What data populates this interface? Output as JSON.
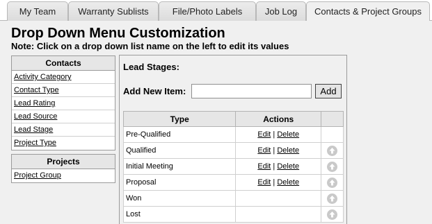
{
  "tabs": [
    {
      "label": "My Team"
    },
    {
      "label": "Warranty Sublists"
    },
    {
      "label": "File/Photo Labels"
    },
    {
      "label": "Job Log"
    },
    {
      "label": "Contacts & Project Groups"
    }
  ],
  "header": {
    "title": "Drop Down Menu Customization",
    "note": "Note: Click on a drop down list name on the left to edit its values"
  },
  "sidebar": {
    "contacts": {
      "heading": "Contacts",
      "items": [
        "Activity Category",
        "Contact Type",
        "Lead Rating",
        "Lead Source",
        "Lead Stage",
        "Project Type"
      ]
    },
    "projects": {
      "heading": "Projects",
      "items": [
        "Project Group"
      ]
    }
  },
  "panel": {
    "title": "Lead Stages:",
    "add_label": "Add New Item:",
    "add_value": "",
    "add_button": "Add",
    "columns": [
      "Type",
      "Actions"
    ],
    "edit_label": "Edit",
    "separator": "|",
    "delete_label": "Delete",
    "rows": [
      {
        "type": "Pre-Qualified",
        "has_actions": true,
        "has_up": false
      },
      {
        "type": "Qualified",
        "has_actions": true,
        "has_up": true
      },
      {
        "type": "Initial Meeting",
        "has_actions": true,
        "has_up": true
      },
      {
        "type": "Proposal",
        "has_actions": true,
        "has_up": true
      },
      {
        "type": "Won",
        "has_actions": false,
        "has_up": true
      },
      {
        "type": "Lost",
        "has_actions": false,
        "has_up": true
      }
    ]
  },
  "colors": {
    "background": "#f0f0f0",
    "header_fill": "#e6e6e6",
    "up_icon": "#c9c9c9"
  },
  "icons": {
    "move_up": "up-arrow-circle-icon"
  }
}
